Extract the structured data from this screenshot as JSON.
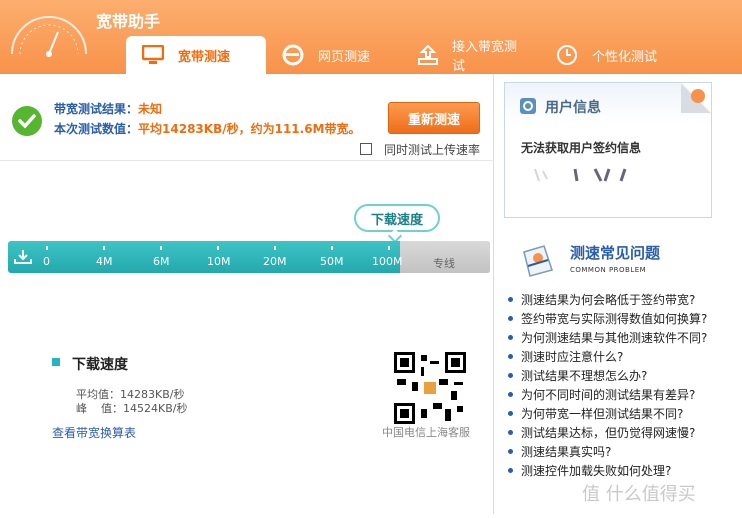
{
  "app": {
    "title": "宽带助手"
  },
  "tabs": [
    {
      "label": "宽带测速",
      "icon": "monitor-icon",
      "active": true
    },
    {
      "label": "网页测速",
      "icon": "ie-browser-icon",
      "active": false
    },
    {
      "label": "接入带宽测试",
      "icon": "upload-tray-icon",
      "active": false
    },
    {
      "label": "个性化测试",
      "icon": "clock-icon",
      "active": false
    }
  ],
  "status": {
    "result_label": "带宽测试结果：",
    "result_value": "未知",
    "speed_label": "本次测试数值：",
    "speed_value": "平均14283KB/秒，约为111.6M带宽。",
    "retest_label": "重新测速",
    "upload_checkbox_label": "同时测试上传速率"
  },
  "speedometer": {
    "bubble_label": "下载速度",
    "ticks": [
      "0",
      "4M",
      "6M",
      "10M",
      "20M",
      "50M",
      "100M",
      "专线"
    ]
  },
  "download": {
    "title": "下载速度",
    "avg_label": "平均值：",
    "avg_value": "14283KB/秒",
    "peak_label": "峰    值：",
    "peak_value": "14524KB/秒",
    "calc_link": "查看带宽换算表",
    "qr_caption": "中国电信上海客服"
  },
  "user_info": {
    "title": "用户信息",
    "message": "无法获取用户签约信息"
  },
  "faq": {
    "title": "测速常见问题",
    "subtitle": "COMMON PROBLEM",
    "items": [
      "测速结果为何会略低于签约带宽?",
      "签约带宽与实际测得数值如何换算?",
      "为何测速结果与其他测速软件不同?",
      "测速时应注意什么?",
      "测试结果不理想怎么办?",
      "为何不同时间的测试结果有差异?",
      "为何带宽一样但测试结果不同?",
      "测试结果达标，但仍觉得网速慢?",
      "测速结果真实吗?",
      "测速控件加载失败如何处理?"
    ]
  },
  "watermark": "值 什么值得买",
  "colors": {
    "accent": "#f8924a",
    "bar": "#2bb5b8",
    "link": "#2a5ea8",
    "ok": "#56b632"
  }
}
